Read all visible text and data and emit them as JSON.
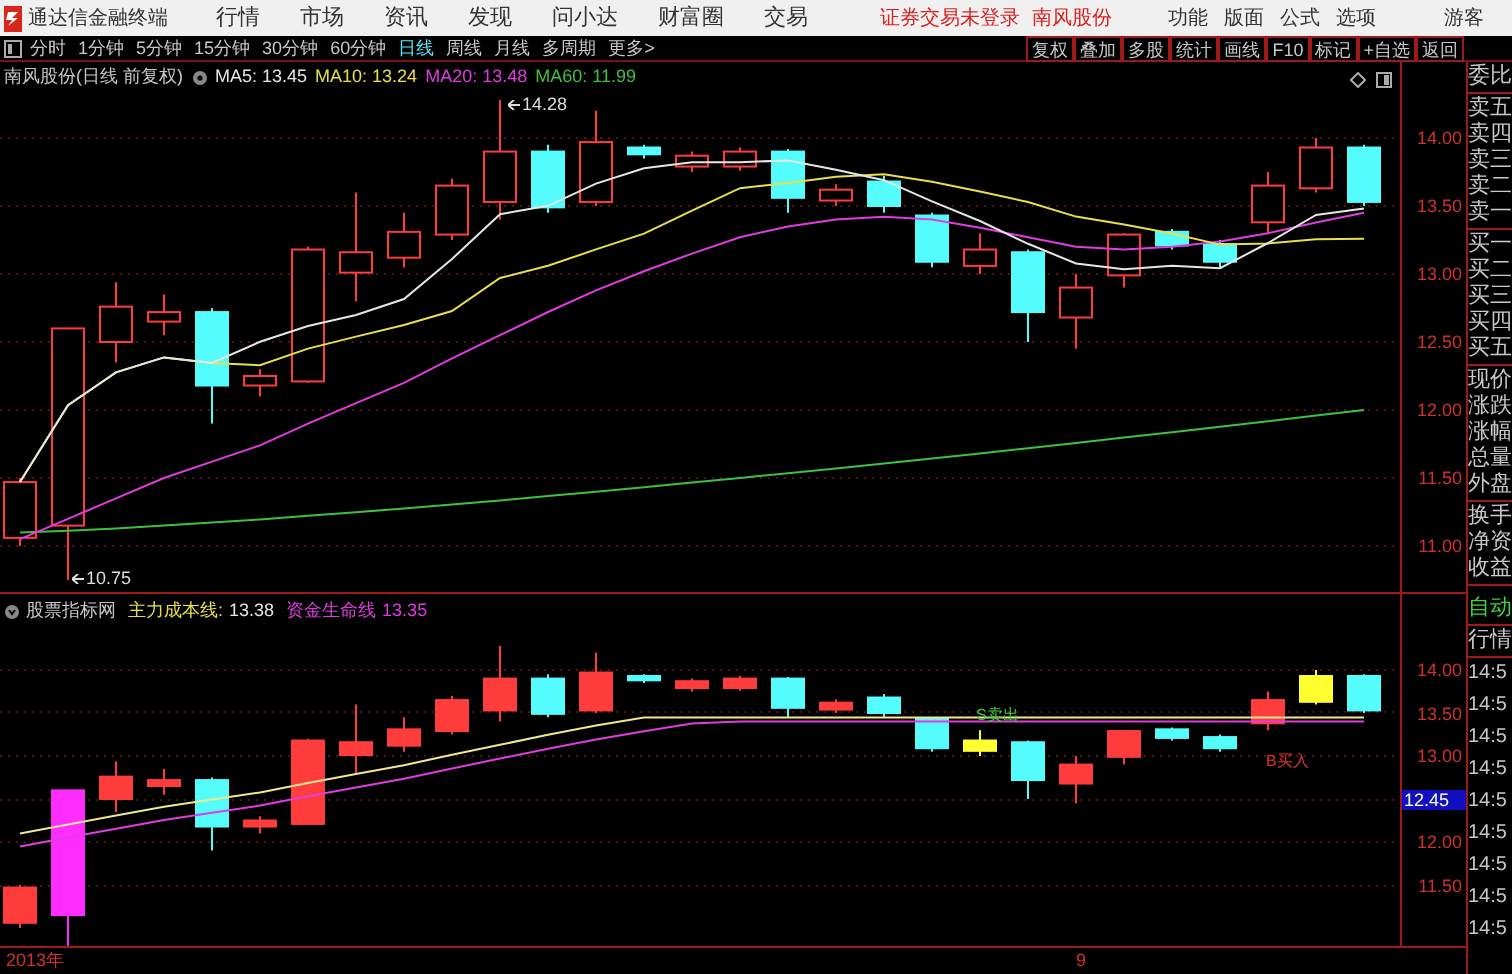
{
  "app": {
    "title": "通达信金融终端"
  },
  "menu": [
    "行情",
    "市场",
    "资讯",
    "发现",
    "问小达",
    "财富圈",
    "交易"
  ],
  "login_status": "证券交易未登录",
  "stock_link": "南风股份",
  "top_menu": [
    "功能",
    "版面",
    "公式",
    "选项"
  ],
  "user": "游客",
  "periods": [
    {
      "label": "分时",
      "selected": false
    },
    {
      "label": "1分钟",
      "selected": false
    },
    {
      "label": "5分钟",
      "selected": false
    },
    {
      "label": "15分钟",
      "selected": false
    },
    {
      "label": "30分钟",
      "selected": false
    },
    {
      "label": "60分钟",
      "selected": false
    },
    {
      "label": "日线",
      "selected": true
    },
    {
      "label": "周线",
      "selected": false
    },
    {
      "label": "月线",
      "selected": false
    },
    {
      "label": "多周期",
      "selected": false
    }
  ],
  "more": "更多>",
  "tools": [
    "复权",
    "叠加",
    "多股",
    "统计",
    "画线",
    "F10",
    "标记",
    "+自选",
    "返回"
  ],
  "main_chart": {
    "title": "南风股份(日线 前复权)",
    "indicators": [
      {
        "label": "MA5: 13.45",
        "color": "#e6e6e6"
      },
      {
        "label": "MA10: 13.24",
        "color": "#e8e04a"
      },
      {
        "label": "MA20: 13.48",
        "color": "#e03ce0"
      },
      {
        "label": "MA60: 11.99",
        "color": "#40c040"
      }
    ],
    "high_marker": "14.28",
    "low_marker": "10.75",
    "y_labels": [
      "14.00",
      "13.50",
      "13.00",
      "12.50",
      "12.00",
      "11.50",
      "11.00"
    ]
  },
  "quote_labels": [
    [
      "委比"
    ],
    [
      "卖五",
      "卖四",
      "卖三",
      "卖二",
      "卖一"
    ],
    [
      "买一",
      "买二",
      "买三",
      "买四",
      "买五"
    ],
    [
      "现价",
      "涨跌",
      "涨幅",
      "总量",
      "外盘"
    ],
    [
      "换手",
      "净资",
      "收益"
    ]
  ],
  "indicator_panel": {
    "source": "股票指标网",
    "lines": [
      {
        "name": "主力成本线:",
        "value": "13.38",
        "color": "#e8e04a"
      },
      {
        "name": "资金生命线",
        "value": "13.35",
        "color": "#e03ce0"
      }
    ],
    "sell_signal": "S卖出",
    "buy_signal": "B买入",
    "y_labels": [
      {
        "label": "14.00",
        "selected": false
      },
      {
        "label": "13.50",
        "selected": false
      },
      {
        "label": "13.00",
        "selected": false
      },
      {
        "label": "12.45",
        "selected": true
      },
      {
        "label": "12.00",
        "selected": false
      },
      {
        "label": "11.50",
        "selected": false
      }
    ]
  },
  "side": {
    "mode": "自动",
    "section": "行情",
    "times": [
      "14:5",
      "14:5",
      "14:5",
      "14:5",
      "14:5",
      "14:5",
      "14:5",
      "14:5",
      "14:5"
    ]
  },
  "x_axis": [
    "2013年",
    "9"
  ]
}
